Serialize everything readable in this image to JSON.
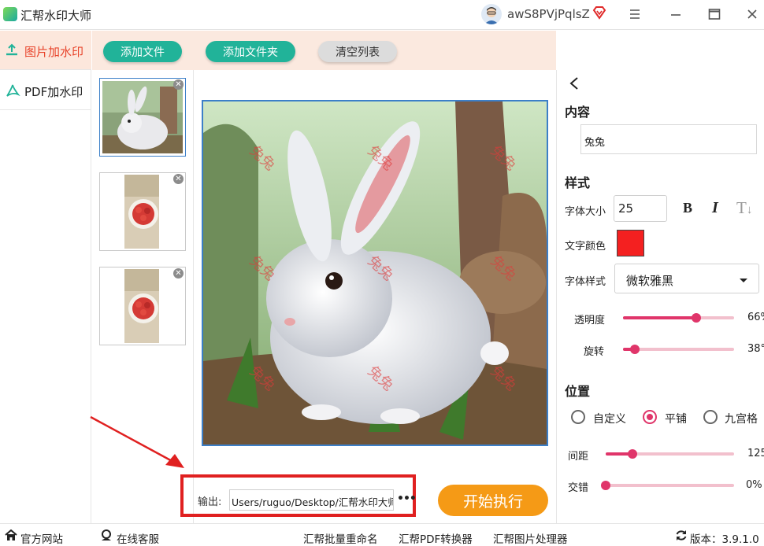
{
  "app": {
    "title": "汇帮水印大师",
    "username": "awS8PVjPqlsZ"
  },
  "nav": {
    "items": [
      {
        "label": "图片加水印"
      },
      {
        "label": "PDF加水印"
      }
    ]
  },
  "toolbar": {
    "add_file": "添加文件",
    "add_folder": "添加文件夹",
    "clear_list": "清空列表"
  },
  "thumbnails": [
    {
      "name": "rabbit"
    },
    {
      "name": "strawberries-1"
    },
    {
      "name": "strawberries-2"
    }
  ],
  "preview": {
    "watermark_text": "兔兔"
  },
  "output": {
    "label": "输出:",
    "path": "Users/ruguo/Desktop/汇帮水印大师",
    "more": "•••",
    "start": "开始执行"
  },
  "settings": {
    "content_heading": "内容",
    "content_value": "兔兔",
    "style_heading": "样式",
    "font_size_label": "字体大小",
    "font_size": "25",
    "bold": "B",
    "italic": "I",
    "text_label": "T",
    "color_label": "文字颜色",
    "color": "#f42020",
    "font_style_label": "字体样式",
    "font_style": "微软雅黑",
    "opacity_label": "透明度",
    "opacity": "66%",
    "opacity_pct": 66,
    "rotate_label": "旋转",
    "rotate": "38°",
    "rotate_deg": 38,
    "position_heading": "位置",
    "position_options": [
      "自定义",
      "平铺",
      "九宫格"
    ],
    "position_selected": "平铺",
    "spacing_label": "间距",
    "spacing": "125",
    "stagger_label": "交错",
    "stagger": "0%"
  },
  "footer": {
    "website": "官方网站",
    "support": "在线客服",
    "rename_tool": "汇帮批量重命名",
    "pdf_tool": "汇帮PDF转换器",
    "image_tool": "汇帮图片处理器",
    "version": "版本：3.9.1.0"
  }
}
